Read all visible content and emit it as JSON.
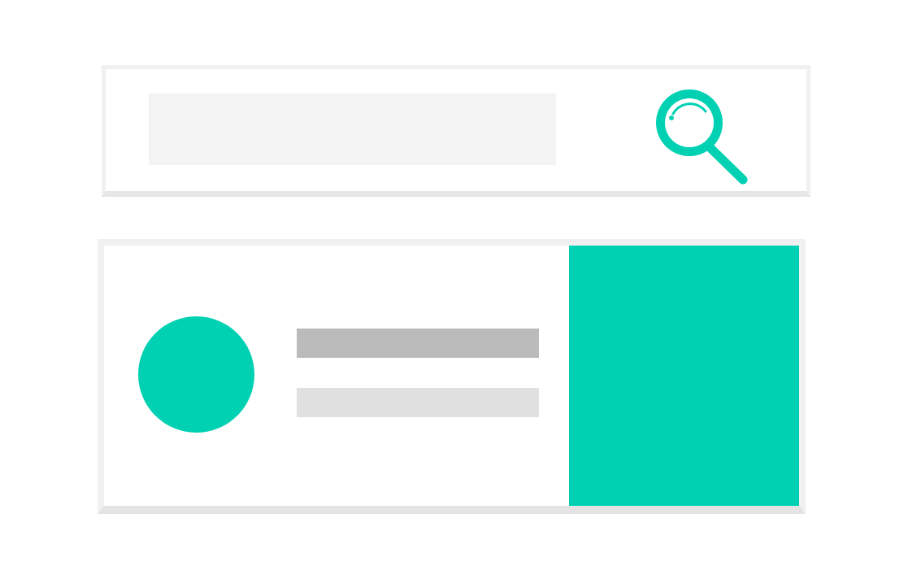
{
  "colors": {
    "accent": "#00d1b2",
    "page_background": "#ffffff",
    "card_border": "#f0f0f0",
    "input_background": "#f3f3f3",
    "primary_line": "#bbbbbb",
    "secondary_line": "#e0e0e0"
  },
  "search": {
    "placeholder": "",
    "value": "",
    "icon": "magnifier-icon"
  },
  "result": {
    "avatar_icon": "avatar-circle",
    "title_text": "",
    "subtitle_text": "",
    "image_icon": "image-placeholder"
  }
}
